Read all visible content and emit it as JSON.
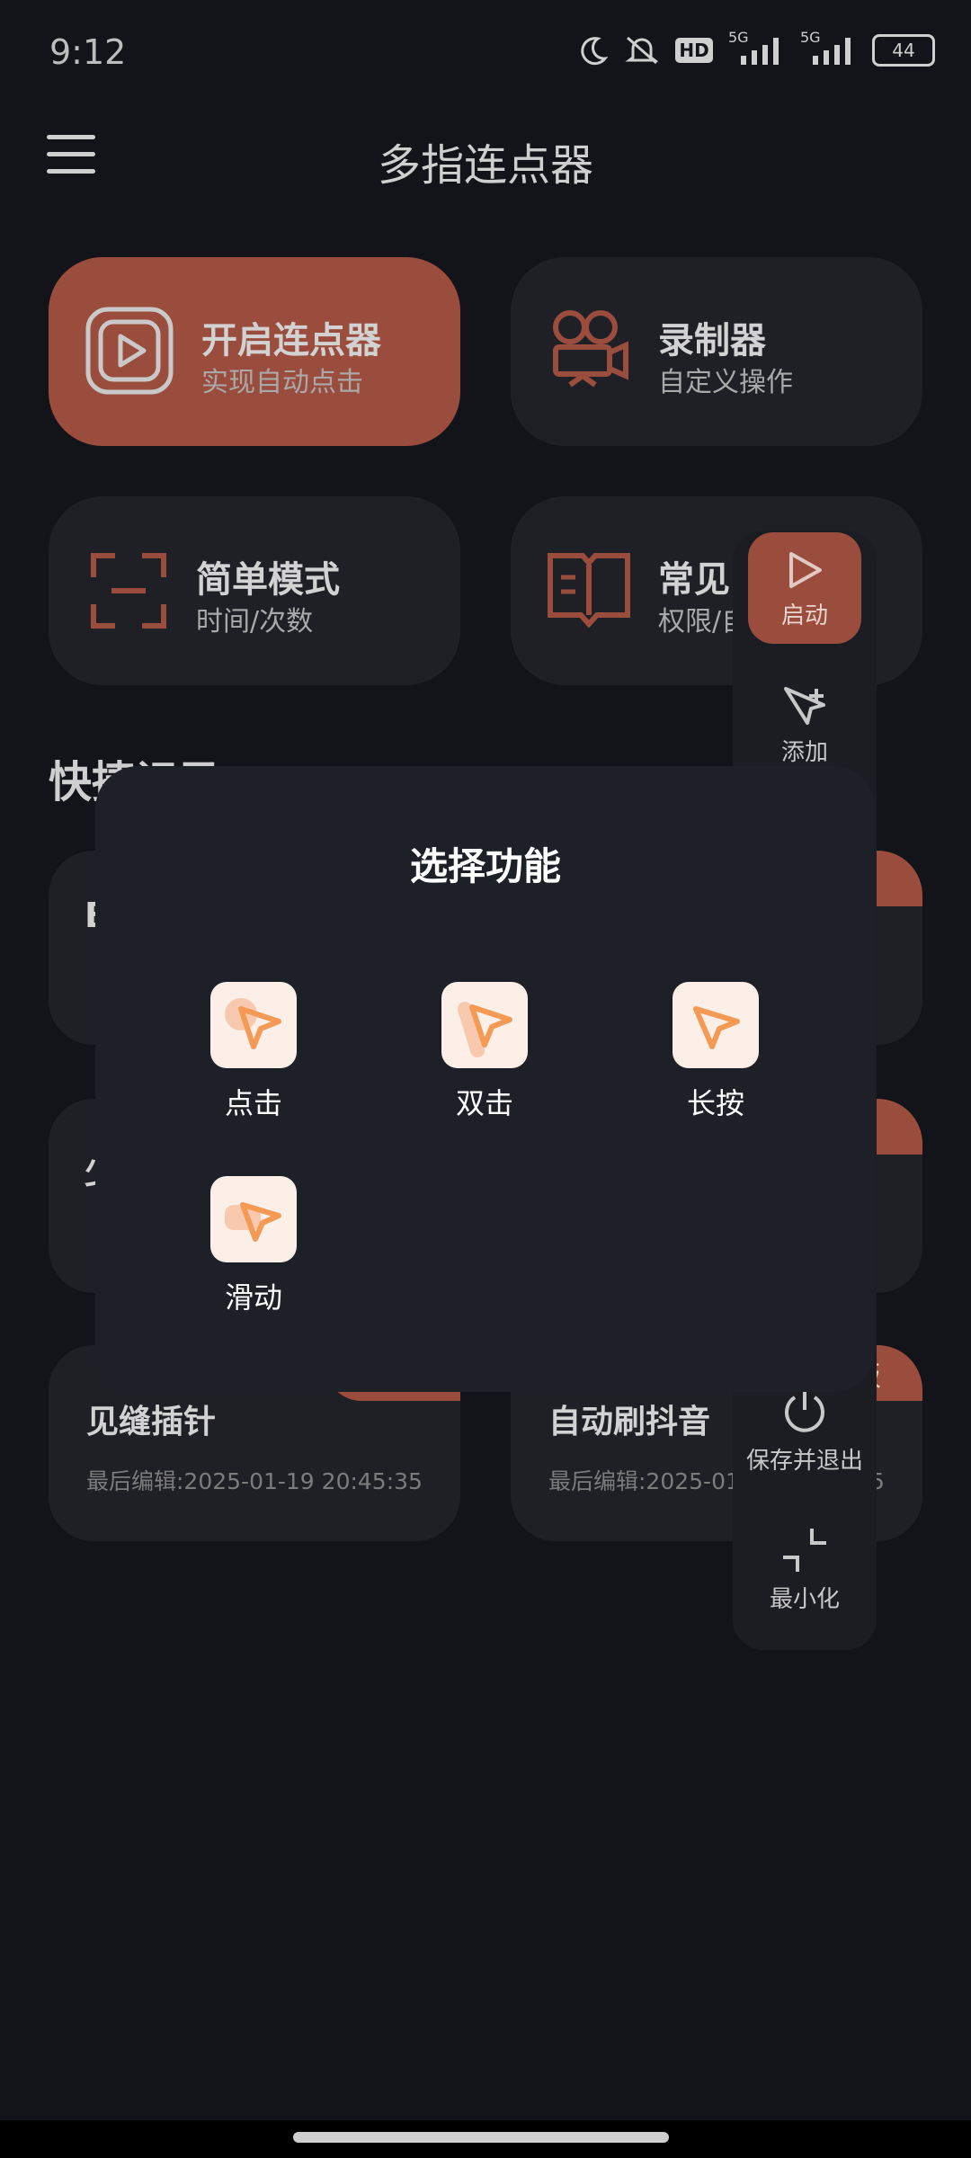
{
  "status_bar": {
    "time": "9:12",
    "network_1": "5G",
    "network_2": "5G",
    "hd_label": "HD",
    "battery": "44",
    "icons": [
      "moon-icon",
      "mute-icon",
      "hd-icon",
      "signal-icon",
      "battery-icon"
    ]
  },
  "header": {
    "title": "多指连点器"
  },
  "cards": {
    "start": {
      "title": "开启连点器",
      "subtitle": "实现自动点击"
    },
    "recorder": {
      "title": "录制器",
      "subtitle": "自定义操作"
    },
    "simple": {
      "title": "简单模式",
      "subtitle": "时间/次数"
    },
    "faq": {
      "title": "常见问",
      "subtitle": "权限/自"
    }
  },
  "section": {
    "title": "快捷记录"
  },
  "list": {
    "item1_partial": "B",
    "item2_partial": "少",
    "item3": {
      "title": "见缝插针",
      "meta": "最后编辑:2025-01-19 20:45:35"
    },
    "item4": {
      "title": "自动刷抖音",
      "meta": "最后编辑:2025-01-19 20:45:35",
      "badge": "面板"
    }
  },
  "floating_panel": {
    "start": "启动",
    "add": "添加",
    "save_exit": "保存并退出",
    "minimize": "最小化"
  },
  "dialog": {
    "title": "选择功能",
    "options": [
      {
        "label": "点击"
      },
      {
        "label": "双击"
      },
      {
        "label": "长按"
      },
      {
        "label": "滑动"
      }
    ]
  },
  "colors": {
    "accent": "#9a4d3d",
    "background": "#131419",
    "card": "#1f2026",
    "dialog": "#1e2028",
    "icon_orange": "#f59a55"
  }
}
